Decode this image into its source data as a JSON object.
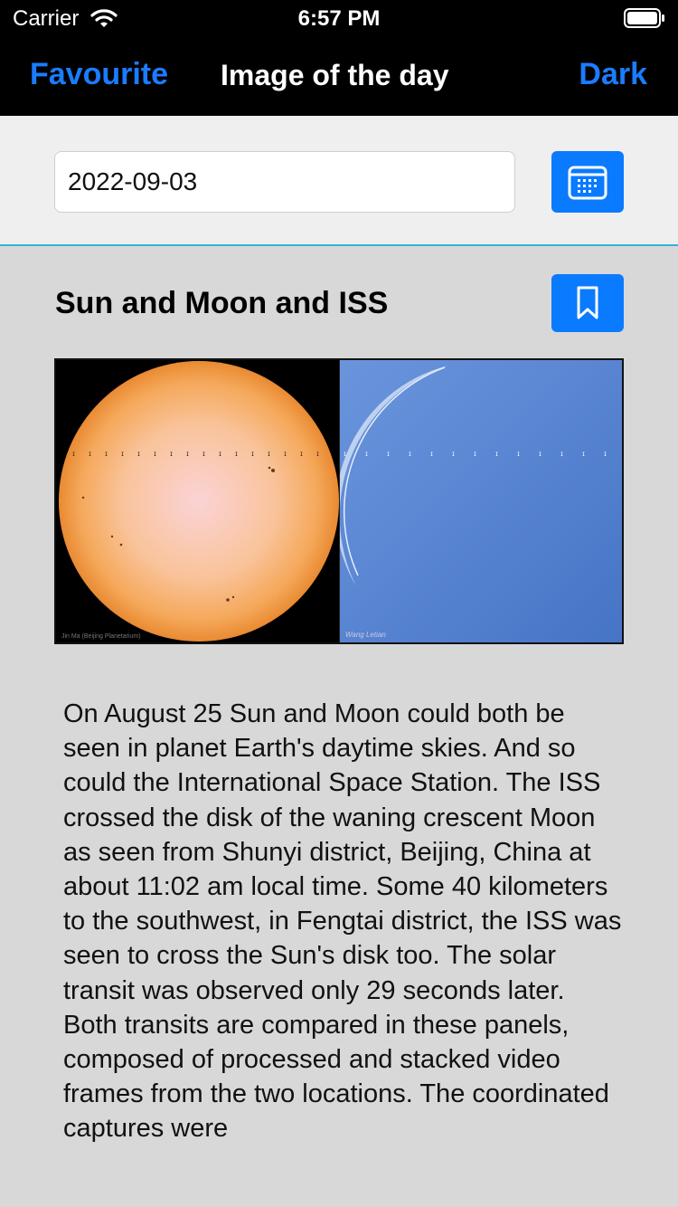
{
  "status_bar": {
    "carrier": "Carrier",
    "time": "6:57 PM"
  },
  "nav": {
    "left_button": "Favourite",
    "title": "Image of the day",
    "right_button": "Dark",
    "accent_color": "#1a7cff"
  },
  "date_picker": {
    "value": "2022-09-03",
    "calendar_icon": "calendar-icon"
  },
  "apod": {
    "title": "Sun and Moon and ISS",
    "bookmark_icon": "bookmark-icon",
    "image_credit_left": "Jin Ma (Beijing Planetarium)",
    "image_credit_right": "Wang Letian",
    "description": "On August 25 Sun and Moon could both be seen in planet Earth's daytime skies. And so could the International Space Station. The ISS crossed the disk of the waning crescent Moon as seen from Shunyi district, Beijing, China at about 11:02 am local time. Some 40 kilometers to the southwest, in Fengtai district, the ISS was seen to cross the Sun's disk too. The solar transit was observed only 29 seconds later. Both transits are compared in these panels, composed of processed and stacked video frames from the two locations. The coordinated captures were"
  },
  "colors": {
    "button_blue": "#0a7aff",
    "divider_cyan": "#2fb6d8"
  }
}
